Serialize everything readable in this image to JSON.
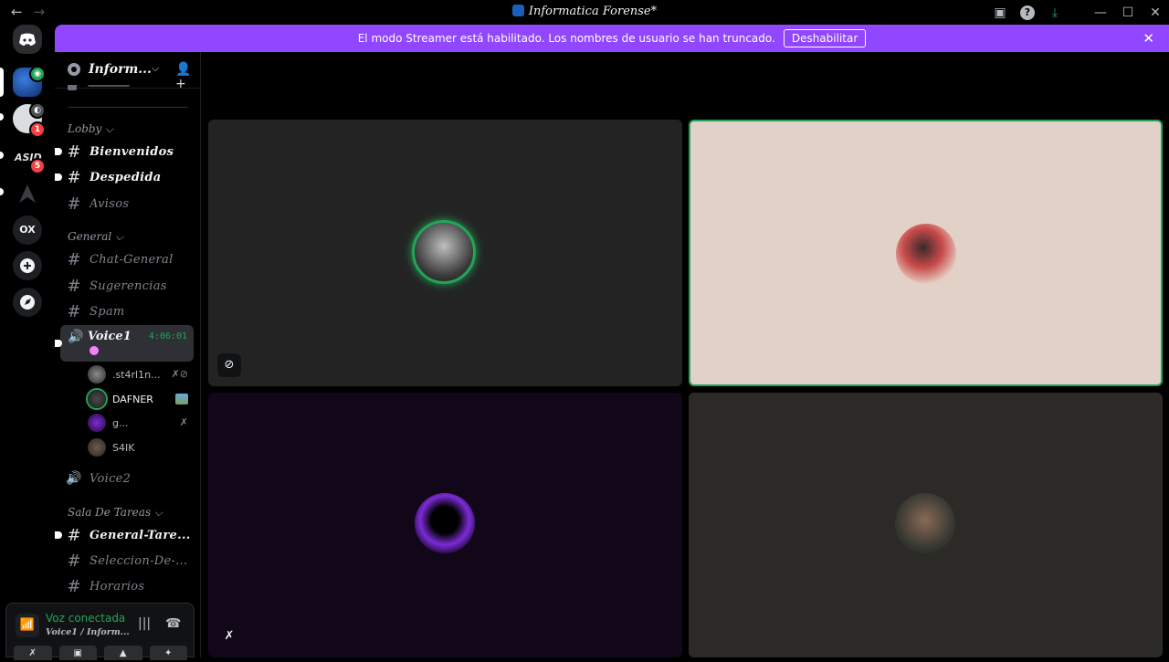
{
  "window": {
    "title": "Informatica Forense*",
    "back_icon": "←",
    "forward_icon": "→",
    "inbox_icon": "▣",
    "help_icon": "?",
    "download_icon": "⤓",
    "minimize_icon": "—",
    "maximize_icon": "☐",
    "close_icon": "✕"
  },
  "banner": {
    "message": "El modo Streamer está habilitado. Los nombres de usuario se han truncado.",
    "button": "Deshabilitar",
    "close_icon": "✕",
    "color": "#9146ff"
  },
  "rail": {
    "servers": [
      {
        "name": "discord-home"
      },
      {
        "name": "Informatica Forense",
        "selected": true
      },
      {
        "name": "server-2",
        "badge": "1"
      },
      {
        "name": "server-3",
        "badge": "5"
      },
      {
        "name": "server-4"
      },
      {
        "name": "OX",
        "label": "OX"
      },
      {
        "name": "add-server",
        "icon": "+"
      },
      {
        "name": "explore",
        "icon": "◉"
      }
    ]
  },
  "sidebar": {
    "server_name": "Inform...",
    "chevron": "⌵",
    "invite_icon": "👤+",
    "categories": [
      {
        "name": "Lobby ⌵",
        "channels": [
          {
            "label": "Bienvenidos",
            "unread": true
          },
          {
            "label": "Despedida",
            "unread": true
          },
          {
            "label": "Avisos",
            "unread": false
          }
        ]
      },
      {
        "name": "General ⌵",
        "channels": [
          {
            "label": "Chat-General",
            "unread": false
          },
          {
            "label": "Sugerencias",
            "unread": false
          },
          {
            "label": "Spam",
            "unread": false
          }
        ]
      },
      {
        "name": "Sala De Tareas ⌵",
        "channels": [
          {
            "label": "General-Tare...",
            "unread": true
          },
          {
            "label": "Seleccion-De-...",
            "unread": false
          },
          {
            "label": "Horarios",
            "unread": false
          }
        ]
      }
    ],
    "hash_icon": "#",
    "speaker_icon": "🔊",
    "voice_active": {
      "label": "Voice1",
      "timer": "4:06:01"
    },
    "voice_users": [
      {
        "name": ".st4rl1n...",
        "status_icons": "✗⊘"
      },
      {
        "name": "DAFNER",
        "live": true
      },
      {
        "name": "g...",
        "status_icons": "✗"
      },
      {
        "name": "S4IK"
      }
    ],
    "voice2": {
      "label": "Voice2"
    }
  },
  "panel": {
    "signal_icon": "📶",
    "status": "Voz conectada",
    "location": "Voice1 / Inform...",
    "noise_icon": "|||",
    "hangup_icon": "☎",
    "buttons": [
      "✗",
      "▣",
      "▲",
      "✦"
    ]
  },
  "video": {
    "hide_icon": "⊘",
    "mute_icon": "✗",
    "speaking_color": "#23a559"
  }
}
